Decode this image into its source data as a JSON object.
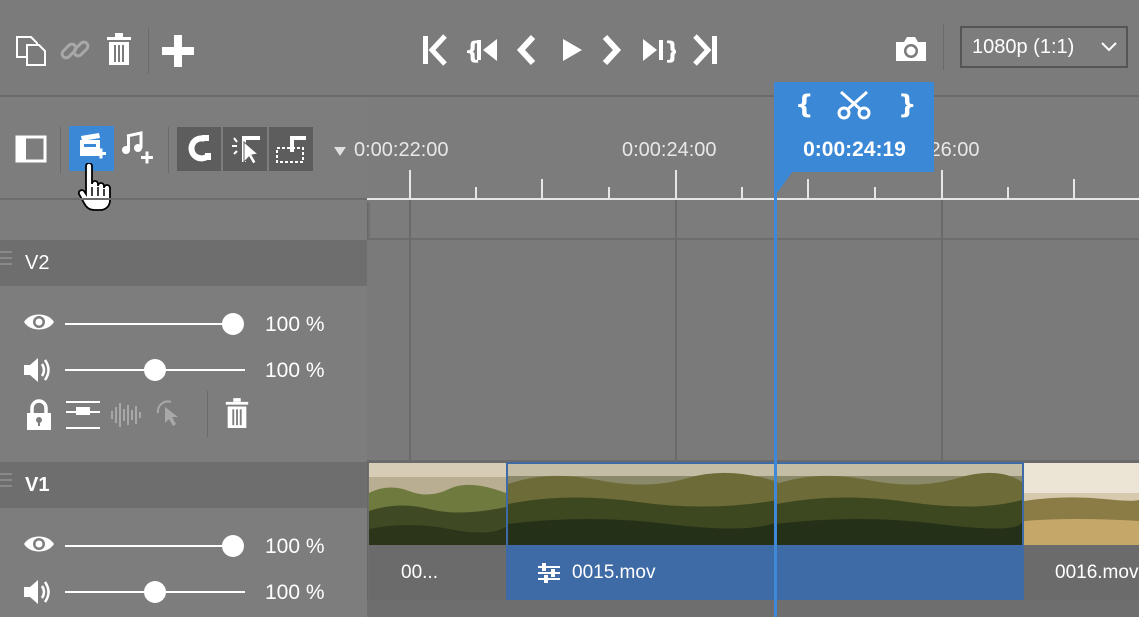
{
  "toolbar": {
    "resolution": "1080p (1:1)"
  },
  "ruler": {
    "labels": [
      "0:00:22:00",
      "0:00:24:00",
      "0:00:26:00"
    ]
  },
  "playhead": {
    "time": "0:00:24:19"
  },
  "tracks": [
    {
      "name": "V2",
      "opacity_pct": "100 %",
      "volume_pct": "100 %",
      "opacity": 1.0,
      "volume": 0.5
    },
    {
      "name": "V1",
      "opacity_pct": "100 %",
      "volume_pct": "100 %",
      "opacity": 1.0,
      "volume": 0.5
    }
  ],
  "clips": [
    {
      "name": "00..."
    },
    {
      "name": "0015.mov"
    },
    {
      "name": "0016.mov"
    }
  ],
  "colors": {
    "accent": "#3a88d6",
    "selected_clip": "#3e6aa5",
    "panel": "#7d7d7d"
  },
  "icons": {
    "toolbar_left": [
      "copy-icon",
      "link-icon",
      "trash-icon",
      "add-icon"
    ],
    "transport": [
      "skip-start-icon",
      "prev-in-icon",
      "step-back-icon",
      "play-icon",
      "step-forward-icon",
      "next-out-icon",
      "skip-end-icon"
    ],
    "panel_tools": [
      "toggle-panel-icon",
      "add-video-track-icon",
      "add-audio-track-icon",
      "magnet-icon",
      "ripple-select-icon",
      "ripple-marquee-icon",
      "more-icon"
    ]
  }
}
